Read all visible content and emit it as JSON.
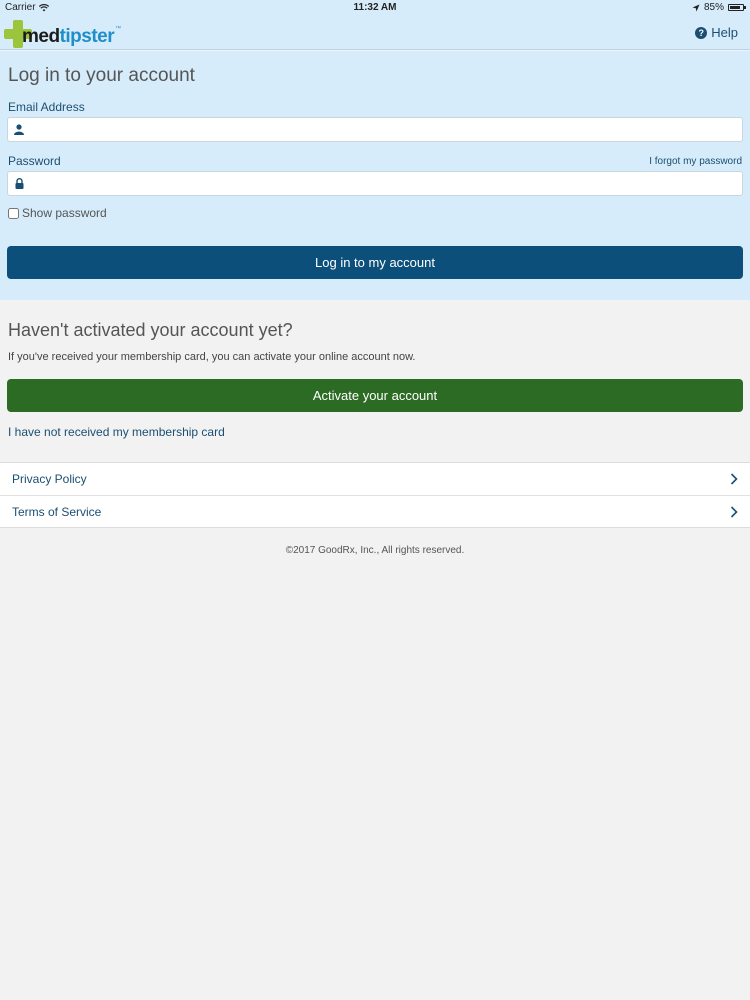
{
  "status": {
    "carrier": "Carrier",
    "time": "11:32 AM",
    "battery": "85%"
  },
  "header": {
    "logo_part1": "med",
    "logo_part2": "tipster",
    "help": "Help"
  },
  "login": {
    "title": "Log in to your account",
    "email_label": "Email Address",
    "email_value": "",
    "password_label": "Password",
    "password_value": "",
    "forgot": "I forgot my password",
    "show_password": "Show password",
    "submit": "Log in to my account"
  },
  "activate": {
    "title": "Haven't activated your account yet?",
    "description": "If you've received your membership card, you can activate your online account now.",
    "button": "Activate your account",
    "no_card": "I have not received my membership card"
  },
  "links": [
    {
      "label": "Privacy Policy"
    },
    {
      "label": "Terms of Service"
    }
  ],
  "footer": {
    "copyright": "©2017 GoodRx, Inc., All rights reserved."
  },
  "colors": {
    "primary": "#0b4f7a",
    "activate": "#2c6b24",
    "login_bg": "#d7ecfb",
    "logo_green": "#9bc53d",
    "logo_blue": "#1f8fc9"
  },
  "icons": {
    "email": "user-icon",
    "password": "lock-icon",
    "help": "question-circle-icon",
    "row": "chevron-right-icon"
  }
}
